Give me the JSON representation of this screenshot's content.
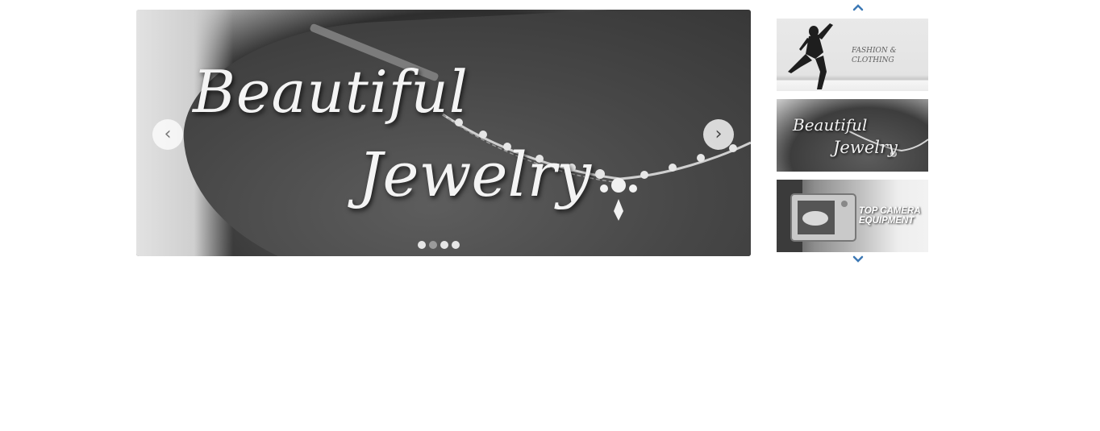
{
  "slider": {
    "headline_line1": "Beautiful",
    "headline_line2": "Jewelry",
    "prev_symbol": "‹",
    "next_symbol": "›",
    "prev_icon": "chevron-left-icon",
    "next_icon": "chevron-right-icon",
    "dot_count": 4,
    "active_dot": 2
  },
  "thumbnails": {
    "up_icon": "chevron-up-icon",
    "down_icon": "chevron-down-icon",
    "accent_color": "#3d79b5",
    "items": [
      {
        "line1": "FASHION &",
        "line2": "CLOTHING"
      },
      {
        "line1": "Beautiful",
        "line2": "Jewelry"
      },
      {
        "line1": "TOP CAMERA",
        "line2": "EQUIPMENT"
      }
    ]
  }
}
